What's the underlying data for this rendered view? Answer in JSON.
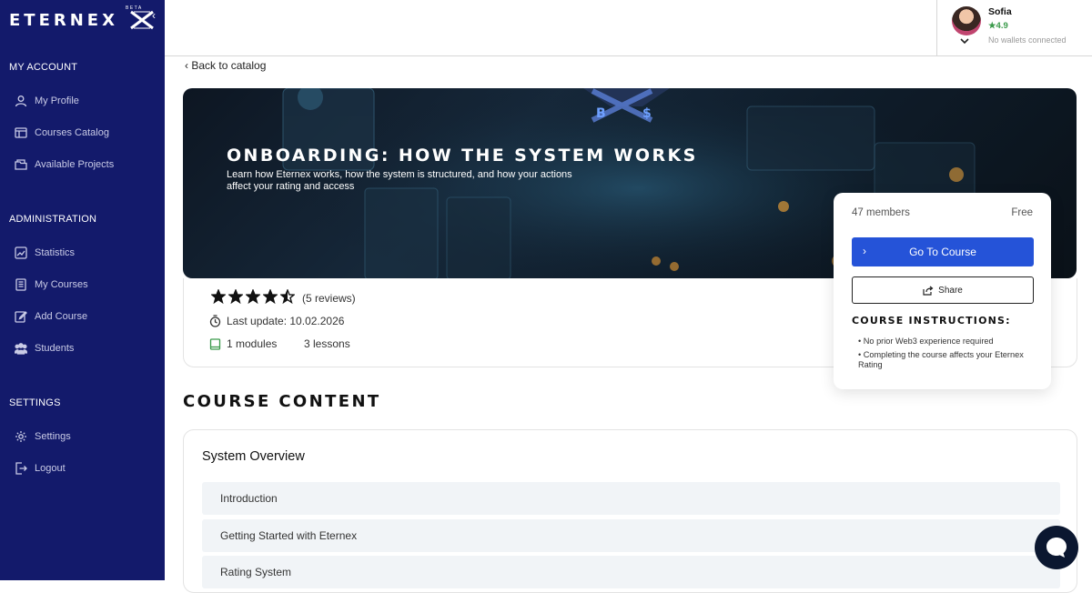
{
  "sidebar": {
    "logo": "ETERNEX",
    "logo_badge": "BETA",
    "sections": [
      {
        "title": "MY ACCOUNT",
        "items": [
          {
            "label": "My Profile",
            "icon": "user-icon"
          },
          {
            "label": "Courses Catalog",
            "icon": "catalog-icon"
          },
          {
            "label": "Available Projects",
            "icon": "projects-icon"
          }
        ]
      },
      {
        "title": "ADMINISTRATION",
        "items": [
          {
            "label": "Statistics",
            "icon": "chart-icon"
          },
          {
            "label": "My Courses",
            "icon": "document-icon"
          },
          {
            "label": "Add Course",
            "icon": "edit-icon"
          },
          {
            "label": "Students",
            "icon": "group-icon"
          }
        ]
      },
      {
        "title": "SETTINGS",
        "items": [
          {
            "label": "Settings",
            "icon": "gear-icon"
          },
          {
            "label": "Logout",
            "icon": "logout-icon"
          }
        ]
      }
    ]
  },
  "user": {
    "name": "Sofia",
    "rating": "4.9",
    "wallet_status": "No wallets connected"
  },
  "back_link": "Back to catalog",
  "course": {
    "title": "Onboarding: How the system works",
    "subtitle": "Learn how Eternex works, how the system is structured, and how your actions affect your rating and access",
    "rating_stars": 4.5,
    "reviews": "(5 reviews)",
    "last_update": "Last update: 10.02.2026",
    "modules": "1 modules",
    "lessons": "3 lessons"
  },
  "side_panel": {
    "members": "47 members",
    "price": "Free",
    "go_button": "Go To Course",
    "share_button": "Share",
    "instructions_title": "Course instructions:",
    "instructions": [
      "• No prior Web3 experience required",
      "• Completing the course affects your Eternex Rating"
    ]
  },
  "content": {
    "title": "Course content",
    "module_title": "System Overview",
    "lessons": [
      "Introduction",
      "Getting Started with Eternex",
      "Rating System"
    ]
  },
  "colors": {
    "sidebar_bg": "#131a6b",
    "primary_button": "#2553d8",
    "rating_green": "#3a9a4a"
  }
}
